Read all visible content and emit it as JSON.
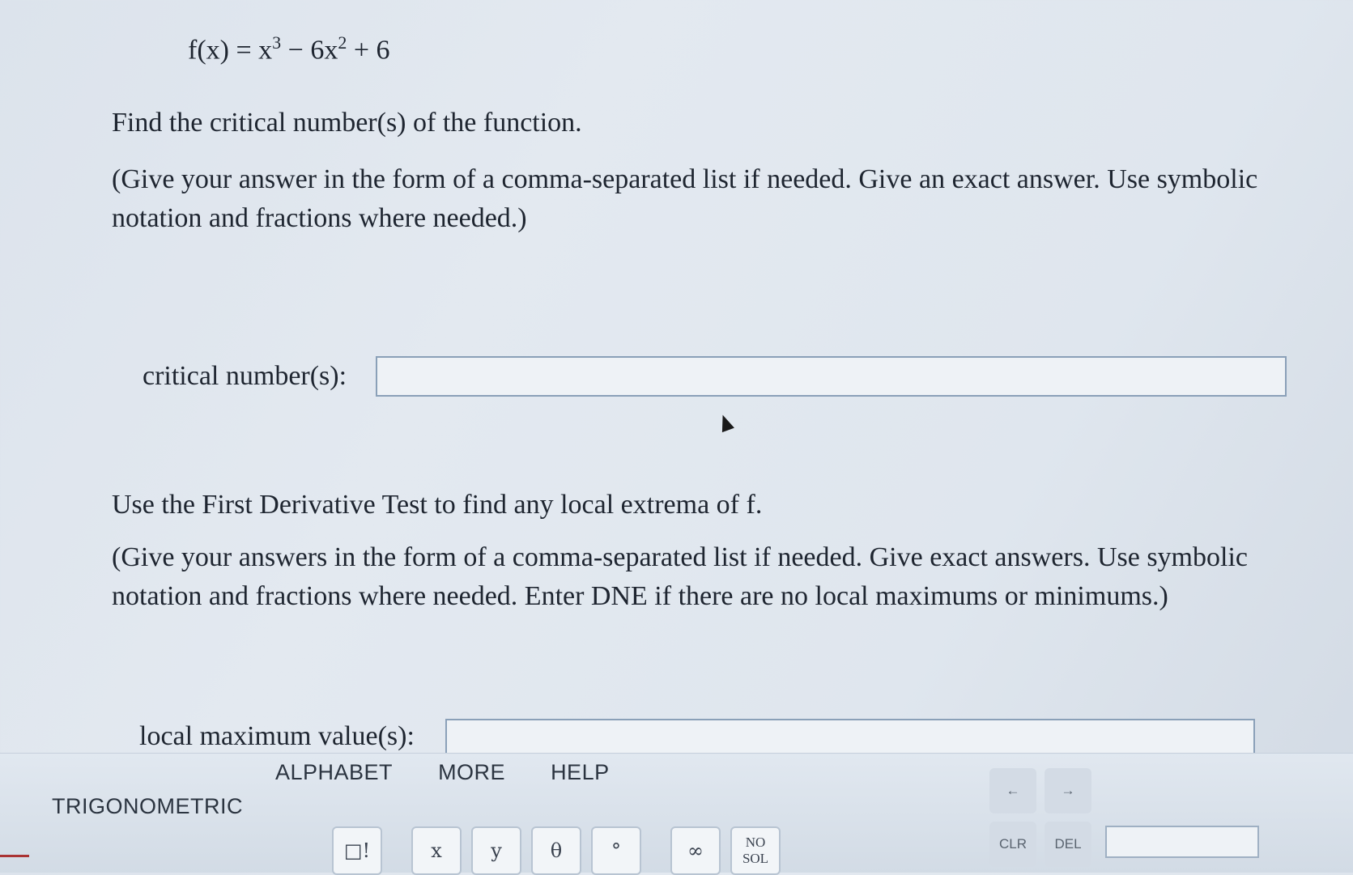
{
  "formula": {
    "lhs": "f(x) = x",
    "exp1": "3",
    "mid": " − 6x",
    "exp2": "2",
    "rhs": " + 6"
  },
  "question1": {
    "prompt": "Find the critical number(s) of the function.",
    "note": "(Give your answer in the form of a comma-separated list if needed. Give an exact answer. Use symbolic notation and fractions where needed.)"
  },
  "critical_field": {
    "label": "critical number(s):",
    "value": ""
  },
  "question2": {
    "prompt": "Use the First Derivative Test to find any local extrema of f.",
    "note": "(Give your answers in the form of a comma-separated list if needed. Give exact answers. Use symbolic notation and fractions where needed. Enter DNE if there are no local maximums or minimums.)"
  },
  "local_max_field": {
    "label": "local maximum value(s):",
    "value": ""
  },
  "keypad": {
    "tabs": [
      "ALPHABET",
      "MORE",
      "HELP"
    ],
    "first_tab": "TRIGONOMETRIC",
    "keys": [
      "□!",
      "x",
      "y",
      "θ",
      "°",
      "∞"
    ],
    "no_sol_line1": "NO",
    "no_sol_line2": "SOL",
    "arrow_left": "←",
    "arrow_right": "→",
    "clear": "CLR",
    "delete": "DEL"
  }
}
